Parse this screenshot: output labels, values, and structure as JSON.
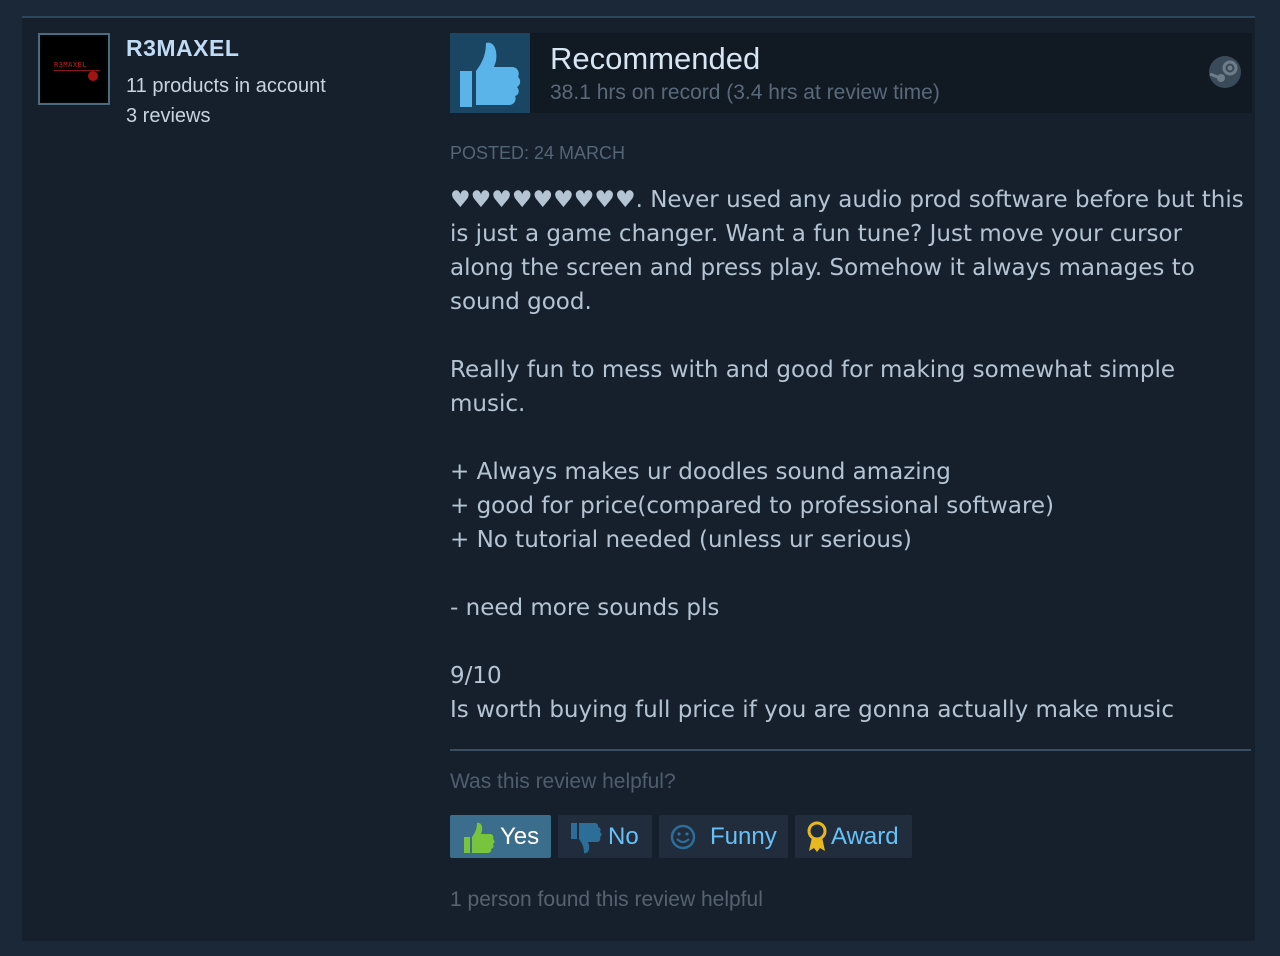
{
  "author": {
    "avatar_text": "R3MAXEL",
    "name": "R3MAXEL",
    "products": "11 products in account",
    "reviews": "3 reviews"
  },
  "review": {
    "verdict": "Recommended",
    "hours": "38.1 hrs on record (3.4 hrs at review time)",
    "posted": "Posted: 24 March",
    "paragraphs": [
      "♥♥♥♥♥♥♥♥♥. Never used any audio prod software before but this is just a game changer. Want a fun tune? Just move your cursor along the screen and press play. Somehow it always manages to sound good.",
      "Really fun to mess with and good for making somewhat simple music.",
      "+ Always makes ur doodles sound amazing\n+ good for price(compared to professional software)\n+ No tutorial needed (unless ur serious)",
      "- need more sounds pls",
      "9/10\nIs worth buying full price if you are gonna actually make music"
    ]
  },
  "feedback": {
    "question": "Was this review helpful?",
    "yes_label": "Yes",
    "no_label": "No",
    "funny_label": "Funny",
    "award_label": "Award",
    "found_helpful": "1 person found this review helpful"
  },
  "icons": {
    "recommend": "thumbs-up-icon",
    "steam": "steam-logo-icon",
    "yes": "thumbs-up-icon",
    "no": "thumbs-down-icon",
    "funny": "smiley-icon",
    "award": "award-ribbon-icon"
  },
  "colors": {
    "background": "#1b2838",
    "card": "#16202d",
    "accent": "#67c1f5",
    "yes_active": "#3b6e8c",
    "thumb_box": "#1b4663"
  }
}
